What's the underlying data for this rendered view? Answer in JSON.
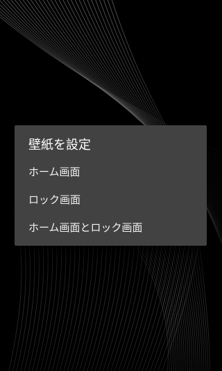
{
  "wallpaper": {
    "description_icon": "dark-silver-curve-lines-wallpaper",
    "colors": {
      "background": "#000000",
      "line": "#bdbdbd"
    }
  },
  "dialog": {
    "title": "壁紙を設定",
    "background": "#424242",
    "options": [
      {
        "label": "ホーム画面"
      },
      {
        "label": "ロック画面"
      },
      {
        "label": "ホーム画面とロック画面"
      }
    ]
  }
}
